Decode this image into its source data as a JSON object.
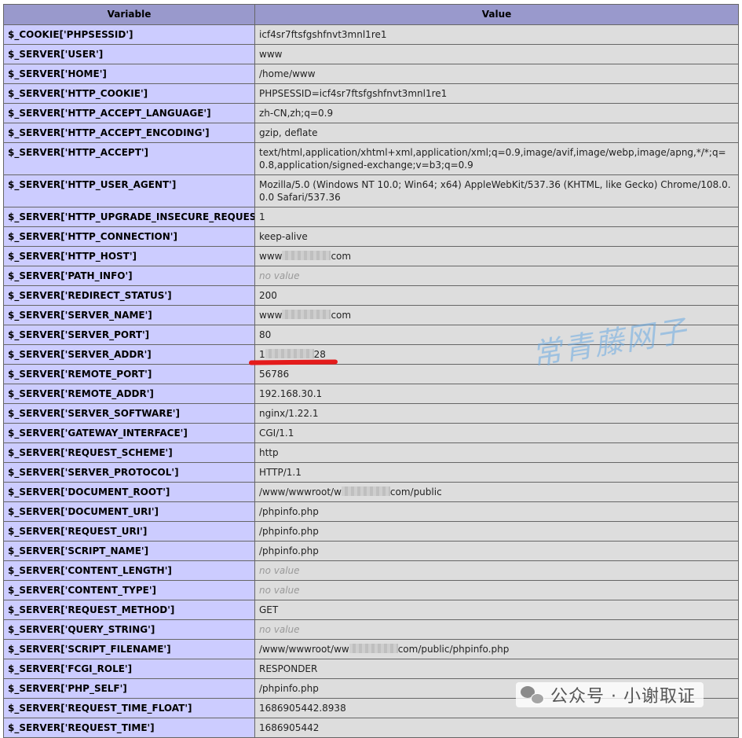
{
  "table": {
    "headers": [
      "Variable",
      "Value"
    ],
    "rows": [
      {
        "variable": "$_COOKIE['PHPSESSID']",
        "value": "icf4sr7ftsfgshfnvt3mnl1re1"
      },
      {
        "variable": "$_SERVER['USER']",
        "value": "www"
      },
      {
        "variable": "$_SERVER['HOME']",
        "value": "/home/www"
      },
      {
        "variable": "$_SERVER['HTTP_COOKIE']",
        "value": "PHPSESSID=icf4sr7ftsfgshfnvt3mnl1re1"
      },
      {
        "variable": "$_SERVER['HTTP_ACCEPT_LANGUAGE']",
        "value": "zh-CN,zh;q=0.9"
      },
      {
        "variable": "$_SERVER['HTTP_ACCEPT_ENCODING']",
        "value": "gzip, deflate"
      },
      {
        "variable": "$_SERVER['HTTP_ACCEPT']",
        "value": "text/html,application/xhtml+xml,application/xml;q=0.9,image/avif,image/webp,image/apng,*/*;q=0.8,application/signed-exchange;v=b3;q=0.9"
      },
      {
        "variable": "$_SERVER['HTTP_USER_AGENT']",
        "value": "Mozilla/5.0 (Windows NT 10.0; Win64; x64) AppleWebKit/537.36 (KHTML, like Gecko) Chrome/108.0.0.0 Safari/537.36"
      },
      {
        "variable": "$_SERVER['HTTP_UPGRADE_INSECURE_REQUESTS']",
        "value": "1"
      },
      {
        "variable": "$_SERVER['HTTP_CONNECTION']",
        "value": "keep-alive"
      },
      {
        "variable": "$_SERVER['HTTP_HOST']",
        "value_prefix": "www",
        "redacted": true,
        "value_suffix": "com"
      },
      {
        "variable": "$_SERVER['PATH_INFO']",
        "value": "no value",
        "no_value": true
      },
      {
        "variable": "$_SERVER['REDIRECT_STATUS']",
        "value": "200"
      },
      {
        "variable": "$_SERVER['SERVER_NAME']",
        "value_prefix": "www",
        "redacted": true,
        "value_suffix": "com"
      },
      {
        "variable": "$_SERVER['SERVER_PORT']",
        "value": "80"
      },
      {
        "variable": "$_SERVER['SERVER_ADDR']",
        "value_prefix": "1",
        "redacted": true,
        "value_suffix": "28"
      },
      {
        "variable": "$_SERVER['REMOTE_PORT']",
        "value": "56786"
      },
      {
        "variable": "$_SERVER['REMOTE_ADDR']",
        "value": "192.168.30.1"
      },
      {
        "variable": "$_SERVER['SERVER_SOFTWARE']",
        "value": "nginx/1.22.1"
      },
      {
        "variable": "$_SERVER['GATEWAY_INTERFACE']",
        "value": "CGI/1.1"
      },
      {
        "variable": "$_SERVER['REQUEST_SCHEME']",
        "value": "http"
      },
      {
        "variable": "$_SERVER['SERVER_PROTOCOL']",
        "value": "HTTP/1.1"
      },
      {
        "variable": "$_SERVER['DOCUMENT_ROOT']",
        "value_prefix": "/www/wwwroot/w",
        "redacted": true,
        "value_suffix": "com/public"
      },
      {
        "variable": "$_SERVER['DOCUMENT_URI']",
        "value": "/phpinfo.php"
      },
      {
        "variable": "$_SERVER['REQUEST_URI']",
        "value": "/phpinfo.php"
      },
      {
        "variable": "$_SERVER['SCRIPT_NAME']",
        "value": "/phpinfo.php"
      },
      {
        "variable": "$_SERVER['CONTENT_LENGTH']",
        "value": "no value",
        "no_value": true
      },
      {
        "variable": "$_SERVER['CONTENT_TYPE']",
        "value": "no value",
        "no_value": true
      },
      {
        "variable": "$_SERVER['REQUEST_METHOD']",
        "value": "GET"
      },
      {
        "variable": "$_SERVER['QUERY_STRING']",
        "value": "no value",
        "no_value": true
      },
      {
        "variable": "$_SERVER['SCRIPT_FILENAME']",
        "value_prefix": "/www/wwwroot/ww",
        "redacted": true,
        "value_suffix": "com/public/phpinfo.php"
      },
      {
        "variable": "$_SERVER['FCGI_ROLE']",
        "value": "RESPONDER"
      },
      {
        "variable": "$_SERVER['PHP_SELF']",
        "value": "/phpinfo.php"
      },
      {
        "variable": "$_SERVER['REQUEST_TIME_FLOAT']",
        "value": "1686905442.8938"
      },
      {
        "variable": "$_SERVER['REQUEST_TIME']",
        "value": "1686905442"
      }
    ]
  },
  "overlays": {
    "watermark_text": "常青藤网子",
    "footer_text": "公众号 · 小谢取证",
    "footer_icon": "wechat-icon",
    "underline_color": "#e41b1b"
  },
  "colors": {
    "header_bg": "#9999cc",
    "variable_bg": "#ccccff",
    "value_bg": "#dddddd",
    "border": "#666666",
    "no_value_text": "#999999"
  }
}
